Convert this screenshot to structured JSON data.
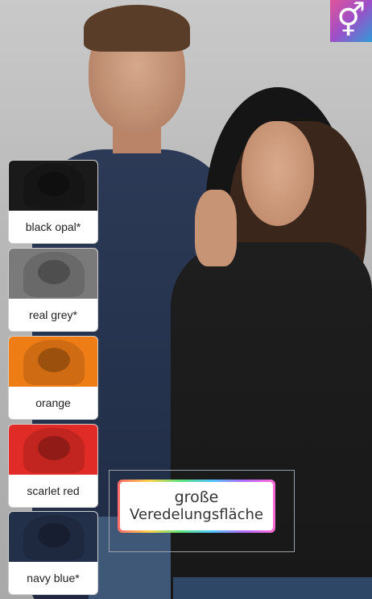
{
  "badge": {
    "icon": "gender-icon",
    "glyph": "⚥"
  },
  "swatches": [
    {
      "label": "black opal*",
      "color": "#1a1a1a"
    },
    {
      "label": "real grey*",
      "color": "#7a7a7a"
    },
    {
      "label": "orange",
      "color": "#ef7d16"
    },
    {
      "label": "scarlet red",
      "color": "#e12b26"
    },
    {
      "label": "navy blue*",
      "color": "#23304a"
    }
  ],
  "feature_label": {
    "line1": "große",
    "line2": "Veredelungsfläche"
  }
}
